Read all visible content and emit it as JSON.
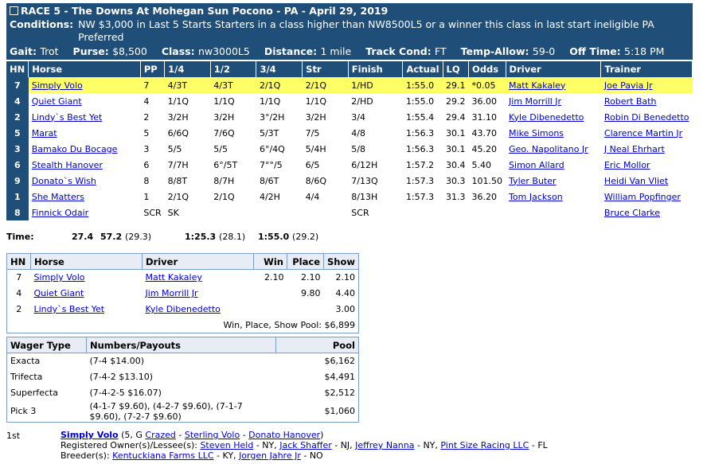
{
  "header": {
    "race_title": "RACE 5 - The Downs At Mohegan Sun Pocono - PA - April 29, 2019",
    "conditions_label": "Conditions:",
    "conditions_text": "NW $3,000 in Last 5 Starts Starters in a class higher than NW8500L5 or a winner this class in last start ineligible PA Preferred",
    "gait_label": "Gait:",
    "gait": "Trot",
    "purse_label": "Purse:",
    "purse": "$8,500",
    "class_label": "Class:",
    "class": "nw3000L5",
    "distance_label": "Distance:",
    "distance": "1 mile",
    "track_label": "Track Cond:",
    "track": "FT",
    "temp_label": "Temp-Allow:",
    "temp": "59-0",
    "off_label": "Off Time:",
    "off": "5:18 PM"
  },
  "results": {
    "columns": [
      "HN",
      "Horse",
      "PP",
      "1/4",
      "1/2",
      "3/4",
      "Str",
      "Finish",
      "Actual",
      "LQ",
      "Odds",
      "Driver",
      "Trainer"
    ],
    "rows": [
      {
        "hn": "7",
        "horse": "Simply Volo",
        "pp": "7",
        "q1": "4/3T",
        "q2": "4/3T",
        "q3": "2/1Q",
        "str": "2/1Q",
        "fin": "1/HD",
        "act": "1:55.0",
        "lq": "29.1",
        "odds": "*0.05",
        "driver": "Matt Kakaley",
        "trainer": "Joe Pavia Jr"
      },
      {
        "hn": "4",
        "horse": "Quiet Giant",
        "pp": "4",
        "q1": "1/1Q",
        "q2": "1/1Q",
        "q3": "1/1Q",
        "str": "1/1Q",
        "fin": "2/HD",
        "act": "1:55.0",
        "lq": "29.2",
        "odds": "36.00",
        "driver": "Jim Morrill Jr",
        "trainer": "Robert Bath"
      },
      {
        "hn": "2",
        "horse": "Lindy`s Best Yet",
        "pp": "2",
        "q1": "3/2H",
        "q2": "3/2H",
        "q3": "3°/2H",
        "str": "3/2H",
        "fin": "3/4",
        "act": "1:55.4",
        "lq": "29.4",
        "odds": "31.10",
        "driver": "Kyle Dibenedetto",
        "trainer": "Robin Di Benedetto"
      },
      {
        "hn": "5",
        "horse": "Marat",
        "pp": "5",
        "q1": "6/6Q",
        "q2": "7/6Q",
        "q3": "5/3T",
        "str": "7/5",
        "fin": "4/8",
        "act": "1:56.3",
        "lq": "30.1",
        "odds": "43.70",
        "driver": "Mike Simons",
        "trainer": "Clarence Martin Jr"
      },
      {
        "hn": "3",
        "horse": "Bamako Du Bocage",
        "pp": "3",
        "q1": "5/5",
        "q2": "5/5",
        "q3": "6°/4Q",
        "str": "5/4H",
        "fin": "5/8",
        "act": "1:56.3",
        "lq": "30.1",
        "odds": "45.20",
        "driver": "Geo. Napolitano Jr",
        "trainer": "J Neal Ehrhart"
      },
      {
        "hn": "6",
        "horse": "Stealth Hanover",
        "pp": "6",
        "q1": "7/7H",
        "q2": "6°/5T",
        "q3": "7°°/5",
        "str": "6/5",
        "fin": "6/12H",
        "act": "1:57.2",
        "lq": "30.4",
        "odds": "5.40",
        "driver": "Simon Allard",
        "trainer": "Eric Mollor"
      },
      {
        "hn": "9",
        "horse": "Donato`s Wish",
        "pp": "8",
        "q1": "8/8T",
        "q2": "8/7H",
        "q3": "8/6T",
        "str": "8/6Q",
        "fin": "7/13Q",
        "act": "1:57.3",
        "lq": "30.3",
        "odds": "101.50",
        "driver": "Tyler Buter",
        "trainer": "Heidi Van Vliet"
      },
      {
        "hn": "1",
        "horse": "She Matters",
        "pp": "1",
        "q1": "2/1Q",
        "q2": "2/1Q",
        "q3": "4/2H",
        "str": "4/4",
        "fin": "8/13H",
        "act": "1:57.3",
        "lq": "31.3",
        "odds": "36.20",
        "driver": "Tom Jackson",
        "trainer": "William Popfinger"
      },
      {
        "hn": "8",
        "horse": "Finnick Odair",
        "pp": "SCR",
        "q1": "SK",
        "q2": "",
        "q3": "",
        "str": "",
        "fin": "SCR",
        "act": "",
        "lq": "",
        "odds": "",
        "driver": "",
        "trainer": "Bruce Clarke"
      }
    ]
  },
  "times": {
    "label": "Time:",
    "t1": "27.4",
    "t2": "57.2",
    "t2p": "(29.3)",
    "t3": "1:25.3",
    "t3p": "(28.1)",
    "t4": "1:55.0",
    "t4p": "(29.2)"
  },
  "payouts": {
    "columns": [
      "HN",
      "Horse",
      "Driver",
      "Win",
      "Place",
      "Show"
    ],
    "rows": [
      {
        "hn": "7",
        "horse": "Simply Volo",
        "driver": "Matt Kakaley",
        "win": "2.10",
        "place": "2.10",
        "show": "2.10"
      },
      {
        "hn": "4",
        "horse": "Quiet Giant",
        "driver": "Jim Morrill Jr",
        "win": "",
        "place": "9.80",
        "show": "4.40"
      },
      {
        "hn": "2",
        "horse": "Lindy`s Best Yet",
        "driver": "Kyle Dibenedetto",
        "win": "",
        "place": "",
        "show": "3.00"
      }
    ],
    "pool_label": "Win, Place, Show Pool: $6,899"
  },
  "wagers": {
    "columns": [
      "Wager Type",
      "Numbers/Payouts",
      "Pool"
    ],
    "rows": [
      {
        "type": "Exacta",
        "nums": "(7-4 $14.00)",
        "pool": "$6,162"
      },
      {
        "type": "Trifecta",
        "nums": "(7-4-2 $13.10)",
        "pool": "$4,491"
      },
      {
        "type": "Superfecta",
        "nums": "(7-4-2-5 $16.07)",
        "pool": "$2,512"
      },
      {
        "type": "Pick 3",
        "nums": "(4-1-7 $9.60), (4-2-7 $9.60), (7-1-7 $9.60), (7-2-7 $9.60)",
        "pool": "$1,060"
      }
    ]
  },
  "winner": {
    "pos": "1st",
    "horse": "Simply Volo",
    "info": "(5, G",
    "sire": "Crazed",
    "dam": "Sterling Volo",
    "damsire": "Donato Hanover",
    "close": ")",
    "owners_label": "Registered Owner(s)/Lessee(s):",
    "owner1": "Steven Held",
    "owner1_loc": "- NY,",
    "owner2": "Jack Shaffer",
    "owner2_loc": "- NJ,",
    "owner3": "Jeffrey Nanna",
    "owner3_loc": "- NY,",
    "owner4": "Pint Size Racing LLC",
    "owner4_loc": "- FL",
    "breeders_label": "Breeder(s):",
    "breeder1": "Kentuckiana Farms LLC",
    "breeder1_loc": "- KY,",
    "breeder2": "Jorgen Jahre Jr",
    "breeder2_loc": "- NO"
  }
}
